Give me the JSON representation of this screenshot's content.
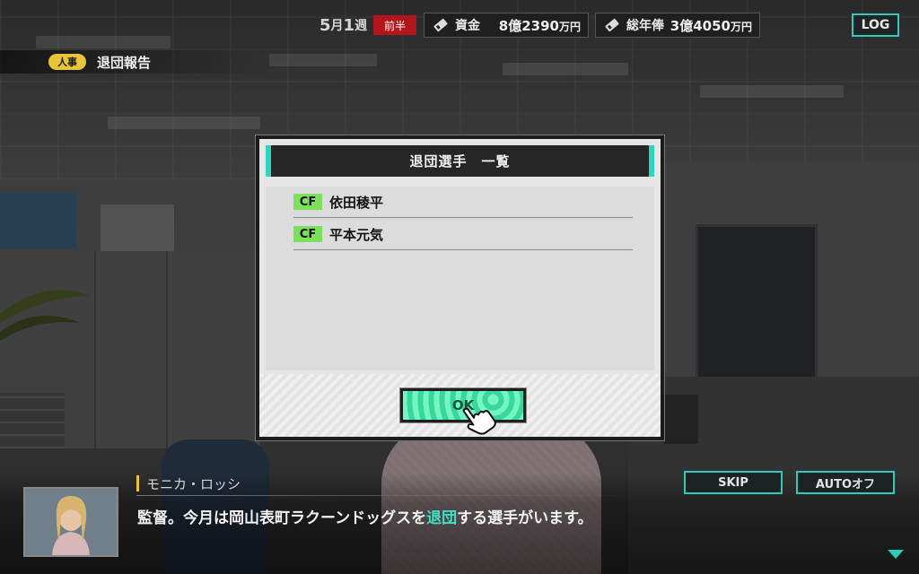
{
  "hud": {
    "week_num": "5",
    "week_month_suffix": "月",
    "week_week_num": "1",
    "week_suffix": "週",
    "half": "前半",
    "funds_label": "資金",
    "funds_value_prefix": "8億2390",
    "funds_value_unit": "万円",
    "payroll_label": "総年俸",
    "payroll_value_prefix": "3億4050",
    "payroll_value_unit": "万円",
    "log_label": "LOG"
  },
  "category": {
    "pill": "人事",
    "title": "退団報告"
  },
  "modal": {
    "title": "退団選手　一覧",
    "players": [
      {
        "position": "CF",
        "name": "依田稜平"
      },
      {
        "position": "CF",
        "name": "平本元気"
      }
    ],
    "ok_label": "OK"
  },
  "dialogue": {
    "speaker": "モニカ・ロッシ",
    "message_before": "監督。今月は岡山表町ラクーンドッグスを",
    "message_highlight": "退団",
    "message_after": "する選手がいます。",
    "skip_label": "SKIP",
    "auto_label": "AUTOオフ"
  },
  "colors": {
    "accent_teal": "#2ecbb8",
    "position_green": "#7be05c",
    "half_red": "#b2151c",
    "pill_yellow": "#e7c43b"
  },
  "icons": {
    "funds": "card-icon",
    "payroll": "card-icon",
    "pointer": "hand-pointer-icon",
    "next": "triangle-down-icon"
  }
}
